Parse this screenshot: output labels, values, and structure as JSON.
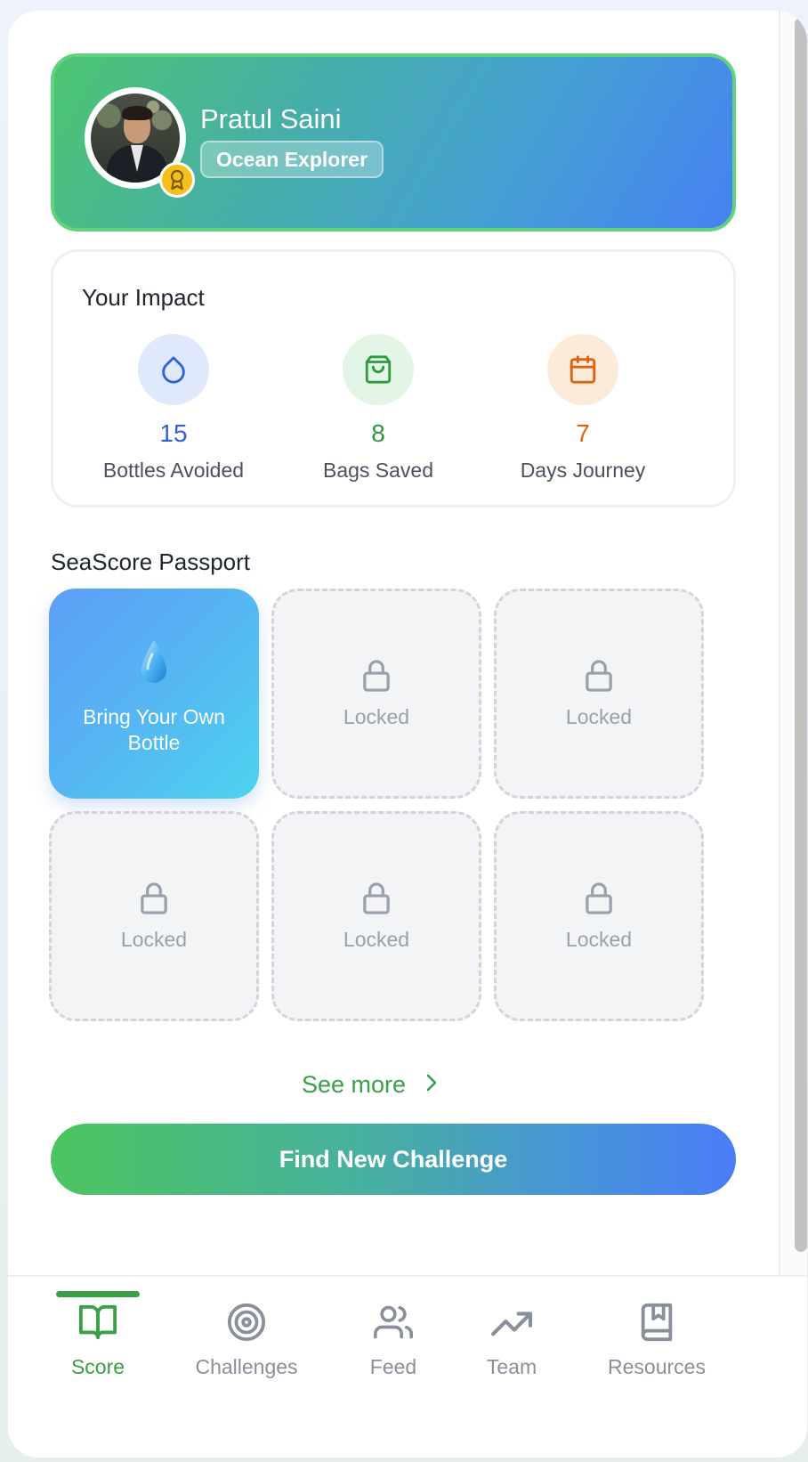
{
  "profile": {
    "name": "Pratul Saini",
    "rank": "Ocean Explorer"
  },
  "impact": {
    "title": "Your Impact",
    "stats": [
      {
        "value": "15",
        "label": "Bottles Avoided",
        "icon": "droplet-icon",
        "color": "#2f5fe0",
        "bg": "#dfe9fb"
      },
      {
        "value": "8",
        "label": "Bags Saved",
        "icon": "shopping-bag-icon",
        "color": "#2e9a3e",
        "bg": "#e3f5e6"
      },
      {
        "value": "7",
        "label": "Days Journey",
        "icon": "calendar-icon",
        "color": "#e0620f",
        "bg": "#fcebd9"
      }
    ]
  },
  "passport": {
    "title": "SeaScore Passport",
    "tiles": [
      {
        "label": "Bring Your Own Bottle",
        "state": "unlocked",
        "icon": "water-drop-icon"
      },
      {
        "label": "Locked",
        "state": "locked",
        "icon": "lock-icon"
      },
      {
        "label": "Locked",
        "state": "locked",
        "icon": "lock-icon"
      },
      {
        "label": "Locked",
        "state": "locked",
        "icon": "lock-icon"
      },
      {
        "label": "Locked",
        "state": "locked",
        "icon": "lock-icon"
      },
      {
        "label": "Locked",
        "state": "locked",
        "icon": "lock-icon"
      }
    ],
    "see_more": "See more"
  },
  "cta": {
    "label": "Find New Challenge"
  },
  "nav": {
    "items": [
      {
        "label": "Score",
        "icon": "book-open-icon",
        "active": true
      },
      {
        "label": "Challenges",
        "icon": "target-icon",
        "active": false
      },
      {
        "label": "Feed",
        "icon": "users-icon",
        "active": false
      },
      {
        "label": "Team",
        "icon": "trending-up-icon",
        "active": false
      },
      {
        "label": "Resources",
        "icon": "bookmark-book-icon",
        "active": false
      }
    ]
  },
  "colors": {
    "accent_green": "#3aa048",
    "inactive": "#8a909b"
  }
}
